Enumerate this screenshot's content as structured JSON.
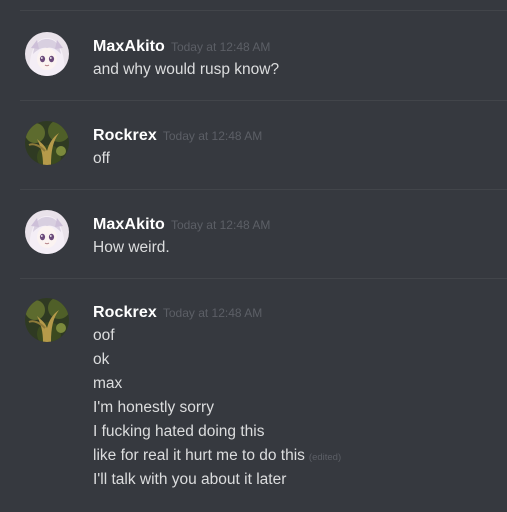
{
  "messages": [
    {
      "author": "MaxAkito",
      "timestamp": "Today at 12:48 AM",
      "avatar_icon": "anime-girl-avatar",
      "lines": [
        "and why would rusp know?"
      ]
    },
    {
      "author": "Rockrex",
      "timestamp": "Today at 12:48 AM",
      "avatar_icon": "tree-avatar",
      "lines": [
        "off"
      ]
    },
    {
      "author": "MaxAkito",
      "timestamp": "Today at 12:48 AM",
      "avatar_icon": "anime-girl-avatar",
      "lines": [
        "How weird."
      ]
    },
    {
      "author": "Rockrex",
      "timestamp": "Today at 12:48 AM",
      "avatar_icon": "tree-avatar",
      "lines": [
        "oof",
        "ok",
        "max",
        "I'm honestly sorry",
        "I fucking hated doing this",
        "like for real it hurt me to do this",
        "I'll talk with you about it later"
      ],
      "edited_label": "(edited)"
    }
  ],
  "colors": {
    "background": "#36393f",
    "divider": "#42454a",
    "username": "#ffffff",
    "text": "#dcddde",
    "timestamp": "#5c5f66"
  }
}
